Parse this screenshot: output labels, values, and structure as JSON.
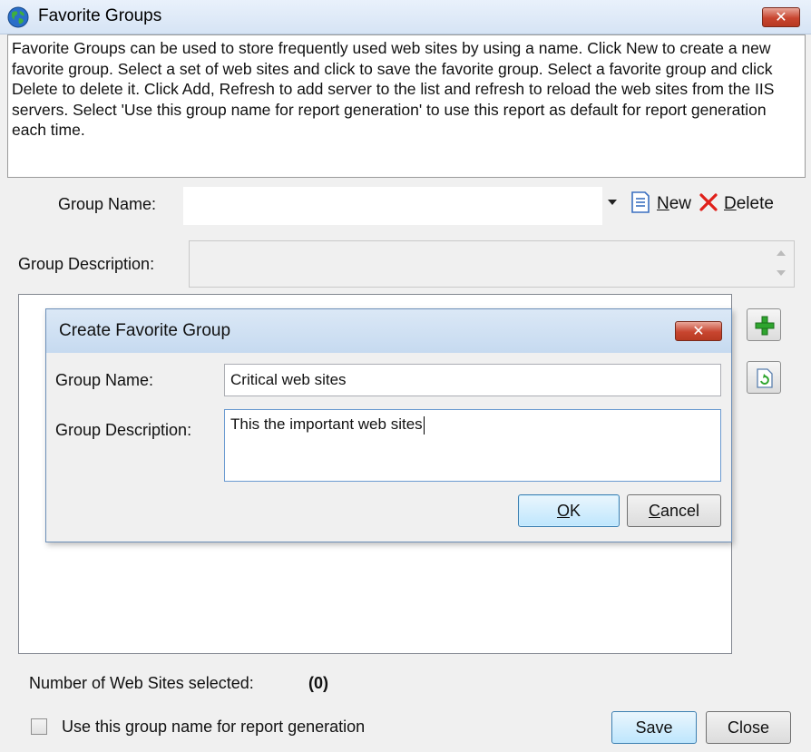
{
  "window": {
    "title": "Favorite Groups",
    "close_glyph": "✕"
  },
  "description": "Favorite Groups can be used to store frequently used web sites by using a name. Click New to create a new favorite group. Select a set of web sites and click to save the favorite group. Select a favorite group and click Delete to delete it. Click Add, Refresh to add server to the list and refresh to reload the web sites from the IIS servers. Select 'Use this group name for report generation' to use this report as default for report generation each time.",
  "group_name": {
    "label": "Group Name:",
    "value": "",
    "new_label": "New",
    "delete_label": "Delete"
  },
  "group_description": {
    "label": "Group Description:",
    "value": ""
  },
  "side_buttons": {
    "add_icon": "add-icon",
    "refresh_icon": "refresh-icon"
  },
  "dialog": {
    "title": "Create Favorite Group",
    "close_glyph": "✕",
    "group_name_label": "Group Name:",
    "group_name_value": "Critical web sites",
    "group_description_label": "Group Description:",
    "group_description_value": "This the important web sites",
    "ok_label": "OK",
    "cancel_label": "Cancel"
  },
  "footer": {
    "count_label": "Number of Web Sites selected:",
    "count_value": "(0)",
    "checkbox_label": "Use this group name for report generation",
    "checkbox_checked": false,
    "save_label": "Save",
    "close_label": "Close"
  },
  "colors": {
    "accent_blue": "#3c7fb1",
    "close_red": "#c8452f",
    "add_green": "#2fa52f"
  }
}
